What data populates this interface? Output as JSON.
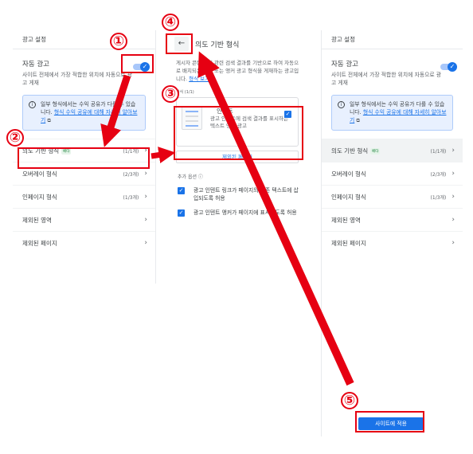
{
  "left_panel": {
    "title": "광고 설정",
    "auto_ads_title": "자동 광고",
    "auto_ads_desc": "사이트 전체에서 가장 적합한 위치에 자동으로 광고 게재",
    "info_text": "일부 형식에서는 수익 공유가 다를 수 있습니다.",
    "info_link": "형식 수익 공유에 대해 자세히 알아보기",
    "items": [
      {
        "label": "의도 기반 형식",
        "badge": "베타",
        "count": "(1/1개)"
      },
      {
        "label": "오버레이 형식",
        "count": "(2/3개)"
      },
      {
        "label": "인페이지 형식",
        "count": "(1/3개)"
      },
      {
        "label": "제외된 영역",
        "count": ""
      },
      {
        "label": "제외된 페이지",
        "count": ""
      }
    ]
  },
  "mid_panel": {
    "back_icon": "arrow-left-icon",
    "title": "의도 기반 형식",
    "desc": "게시자 콘텐츠 및 관련 검색 결과를 기반으로 하여 자동으로 배치되는 링크 또는 앵커 광고 형식을 게재하는 광고입니다.",
    "desc_link": "형식 보기",
    "format_label": "형식 (1/1)",
    "card_title": "인텐트",
    "card_desc": "광고 인텐트에 검색 결과를 표시하는 텍스트 앵커 광고",
    "exclude_button": "제외된 페이지",
    "extra_title": "추가 옵션",
    "extra_options": [
      "광고 인텐트 링크가 페이지의 기존 텍스트에 삽입되도록 허용",
      "광고 인텐트 앵커가 페이지에 표시되도록 허용"
    ]
  },
  "right_panel": {
    "title": "광고 설정",
    "auto_ads_title": "자동 광고",
    "auto_ads_desc": "사이트 전체에서 가장 적합한 위치에 자동으로 광고 게재",
    "info_text": "일부 형식에서는 수익 공유가 다를 수 있습니다.",
    "info_link": "형식 수익 공유에 대해 자세히 알아보기",
    "items": [
      {
        "label": "의도 기반 형식",
        "badge": "베타",
        "count": "(1/1개)"
      },
      {
        "label": "오버레이 형식",
        "count": "(2/3개)"
      },
      {
        "label": "인페이지 형식",
        "count": "(1/3개)"
      },
      {
        "label": "제외된 영역",
        "count": ""
      },
      {
        "label": "제외된 페이지",
        "count": ""
      }
    ],
    "apply_button": "사이트에 적용"
  },
  "annotations": {
    "step1": "①",
    "step2": "②",
    "step3": "③",
    "step4": "④",
    "step5": "⑤",
    "color": "#e60012"
  }
}
